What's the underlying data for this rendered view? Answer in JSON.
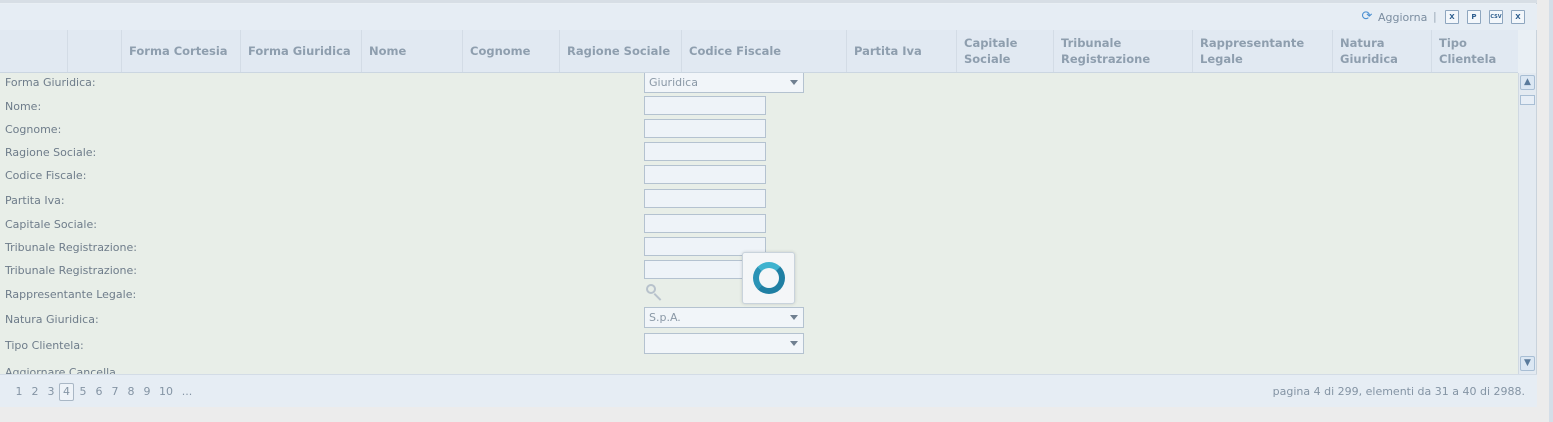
{
  "toolbar": {
    "refresh_label": "Aggiorna",
    "separator": "|",
    "export_buttons": [
      {
        "icon": "excel-icon",
        "glyph": "X"
      },
      {
        "icon": "pdf-icon",
        "glyph": "P"
      },
      {
        "icon": "csv-icon",
        "glyph": "CSV"
      },
      {
        "icon": "xml-icon",
        "glyph": "X"
      }
    ]
  },
  "header": {
    "columns": [
      "",
      "",
      "Forma Cortesia",
      "Forma Giuridica",
      "Nome",
      "Cognome",
      "Ragione Sociale",
      "Codice Fiscale",
      "Partita Iva",
      "Capitale Sociale",
      "Tribunale Registrazione",
      "Rappresentante Legale",
      "Natura Giuridica",
      "Tipo Clientela"
    ]
  },
  "form": {
    "fields": [
      {
        "label": "Forma Giuridica:",
        "type": "select",
        "value": "Giuridica"
      },
      {
        "label": "Nome:",
        "type": "input",
        "value": ""
      },
      {
        "label": "Cognome:",
        "type": "input",
        "value": ""
      },
      {
        "label": "Ragione Sociale:",
        "type": "input",
        "value": ""
      },
      {
        "label": "Codice Fiscale:",
        "type": "input",
        "value": ""
      },
      {
        "label": "Partita Iva:",
        "type": "input",
        "value": ""
      },
      {
        "label": "Capitale Sociale:",
        "type": "input",
        "value": ""
      },
      {
        "label": "Tribunale Registrazione:",
        "type": "input",
        "value": ""
      },
      {
        "label": "Tribunale Registrazione:",
        "type": "input",
        "value": ""
      },
      {
        "label": "Rappresentante Legale:",
        "type": "lookup",
        "value": ""
      },
      {
        "label": "Natura Giuridica:",
        "type": "select",
        "value": "S.p.A."
      },
      {
        "label": "Tipo Clientela:",
        "type": "select",
        "value": ""
      }
    ],
    "actions_text": "Aggiornare Cancella"
  },
  "pager": {
    "pages": [
      "1",
      "2",
      "3",
      "4",
      "5",
      "6",
      "7",
      "8",
      "9",
      "10",
      "..."
    ],
    "current": "4",
    "info": "pagina 4 di 299, elementi da 31 a 40 di 2988."
  },
  "colors": {
    "accent": "#4b8fd1",
    "spinner": "#1f7fa3",
    "form_background": "#e8eee8",
    "header_background": "#e1e9f2"
  }
}
